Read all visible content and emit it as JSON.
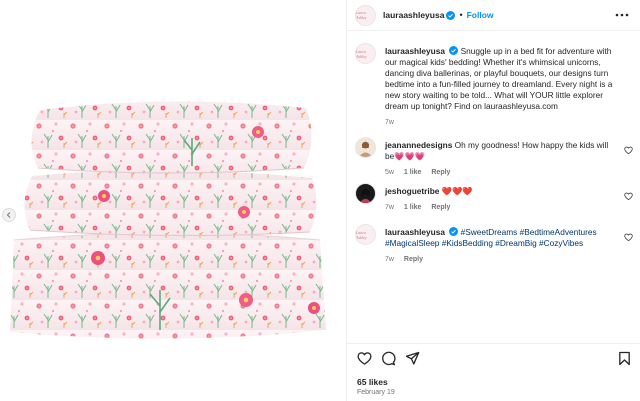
{
  "post": {
    "username": "lauraashleyusa",
    "follow_label": "Follow",
    "separator": "•",
    "avatar_text": "Laura Ashley",
    "caption": {
      "text": "Snuggle up in a bed fit for adventure with our magical kids' bedding! Whether it's whimsical unicorns, dancing diva ballerinas, or playful bouquets, our designs turn bedtime into a fun-filled journey to dreamland. Every night is a new story waiting to be told... What will YOUR little explorer dream up tonight? Find on lauraashleyusa.com",
      "time": "7w"
    },
    "comments": [
      {
        "username": "jeanannedesigns",
        "text": "Oh my goodness! How happy the kids will be💗💗💗",
        "time": "5w",
        "likes": "1 like",
        "reply": "Reply"
      },
      {
        "username": "jeshoguetribe",
        "text": "❤️❤️❤️",
        "time": "7w",
        "likes": "1 like",
        "reply": "Reply"
      },
      {
        "username": "lauraashleyusa",
        "text": "#SweetDreams #BedtimeAdventures #MagicalSleep #KidsBedding #DreamBig #CozyVibes",
        "time": "7w",
        "reply": "Reply"
      }
    ],
    "likes_count": "65 likes",
    "date": "February 19"
  },
  "colors": {
    "link_blue": "#0095f6",
    "verified_blue": "#0095f6",
    "muted": "#737373",
    "hashtag": "#00376b"
  },
  "icons": [
    "more-icon",
    "verified-icon",
    "heart-icon",
    "comment-icon",
    "share-icon",
    "bookmark-icon",
    "chevron-left-icon"
  ]
}
